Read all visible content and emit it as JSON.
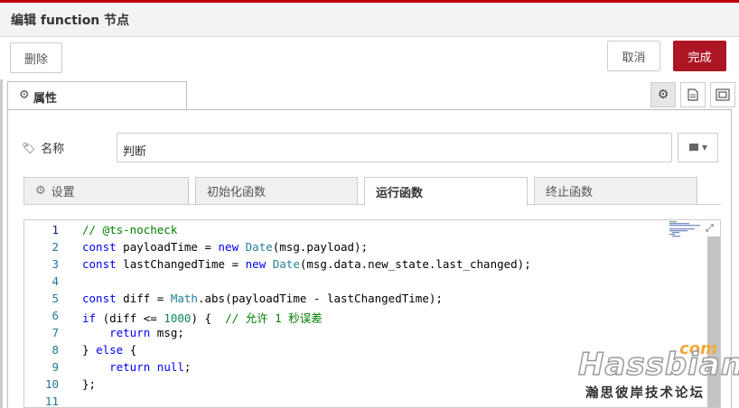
{
  "dialog": {
    "title": "编辑 function 节点",
    "delete_label": "删除",
    "cancel_label": "取消",
    "done_label": "完成"
  },
  "tabs": {
    "properties_label": "属性"
  },
  "name_field": {
    "label": "名称",
    "value": "判断"
  },
  "sub_tabs": [
    {
      "label": "设置"
    },
    {
      "label": "初始化函数"
    },
    {
      "label": "运行函数"
    },
    {
      "label": "终止函数"
    }
  ],
  "editor": {
    "line_numbers": [
      "1",
      "2",
      "3",
      "4",
      "5",
      "6",
      "7",
      "8",
      "9",
      "10",
      "11"
    ],
    "lines": [
      "// @ts-nocheck",
      "const payloadTime = new Date(msg.payload);",
      "const lastChangedTime = new Date(msg.data.new_state.last_changed);",
      "",
      "const diff = Math.abs(payloadTime - lastChangedTime);",
      "if (diff <= 1000) {  // 允许 1 秒误差",
      "    return msg;",
      "} else {",
      "    return null;",
      "};",
      ""
    ]
  },
  "watermark": {
    "com": "com",
    "brand": "Hassbian",
    "subtitle": "瀚思彼岸技术论坛"
  },
  "colors": {
    "accent": "#ad1625",
    "comment": "#008000",
    "keyword": "#0000ff",
    "class": "#267f99",
    "number": "#098658"
  }
}
